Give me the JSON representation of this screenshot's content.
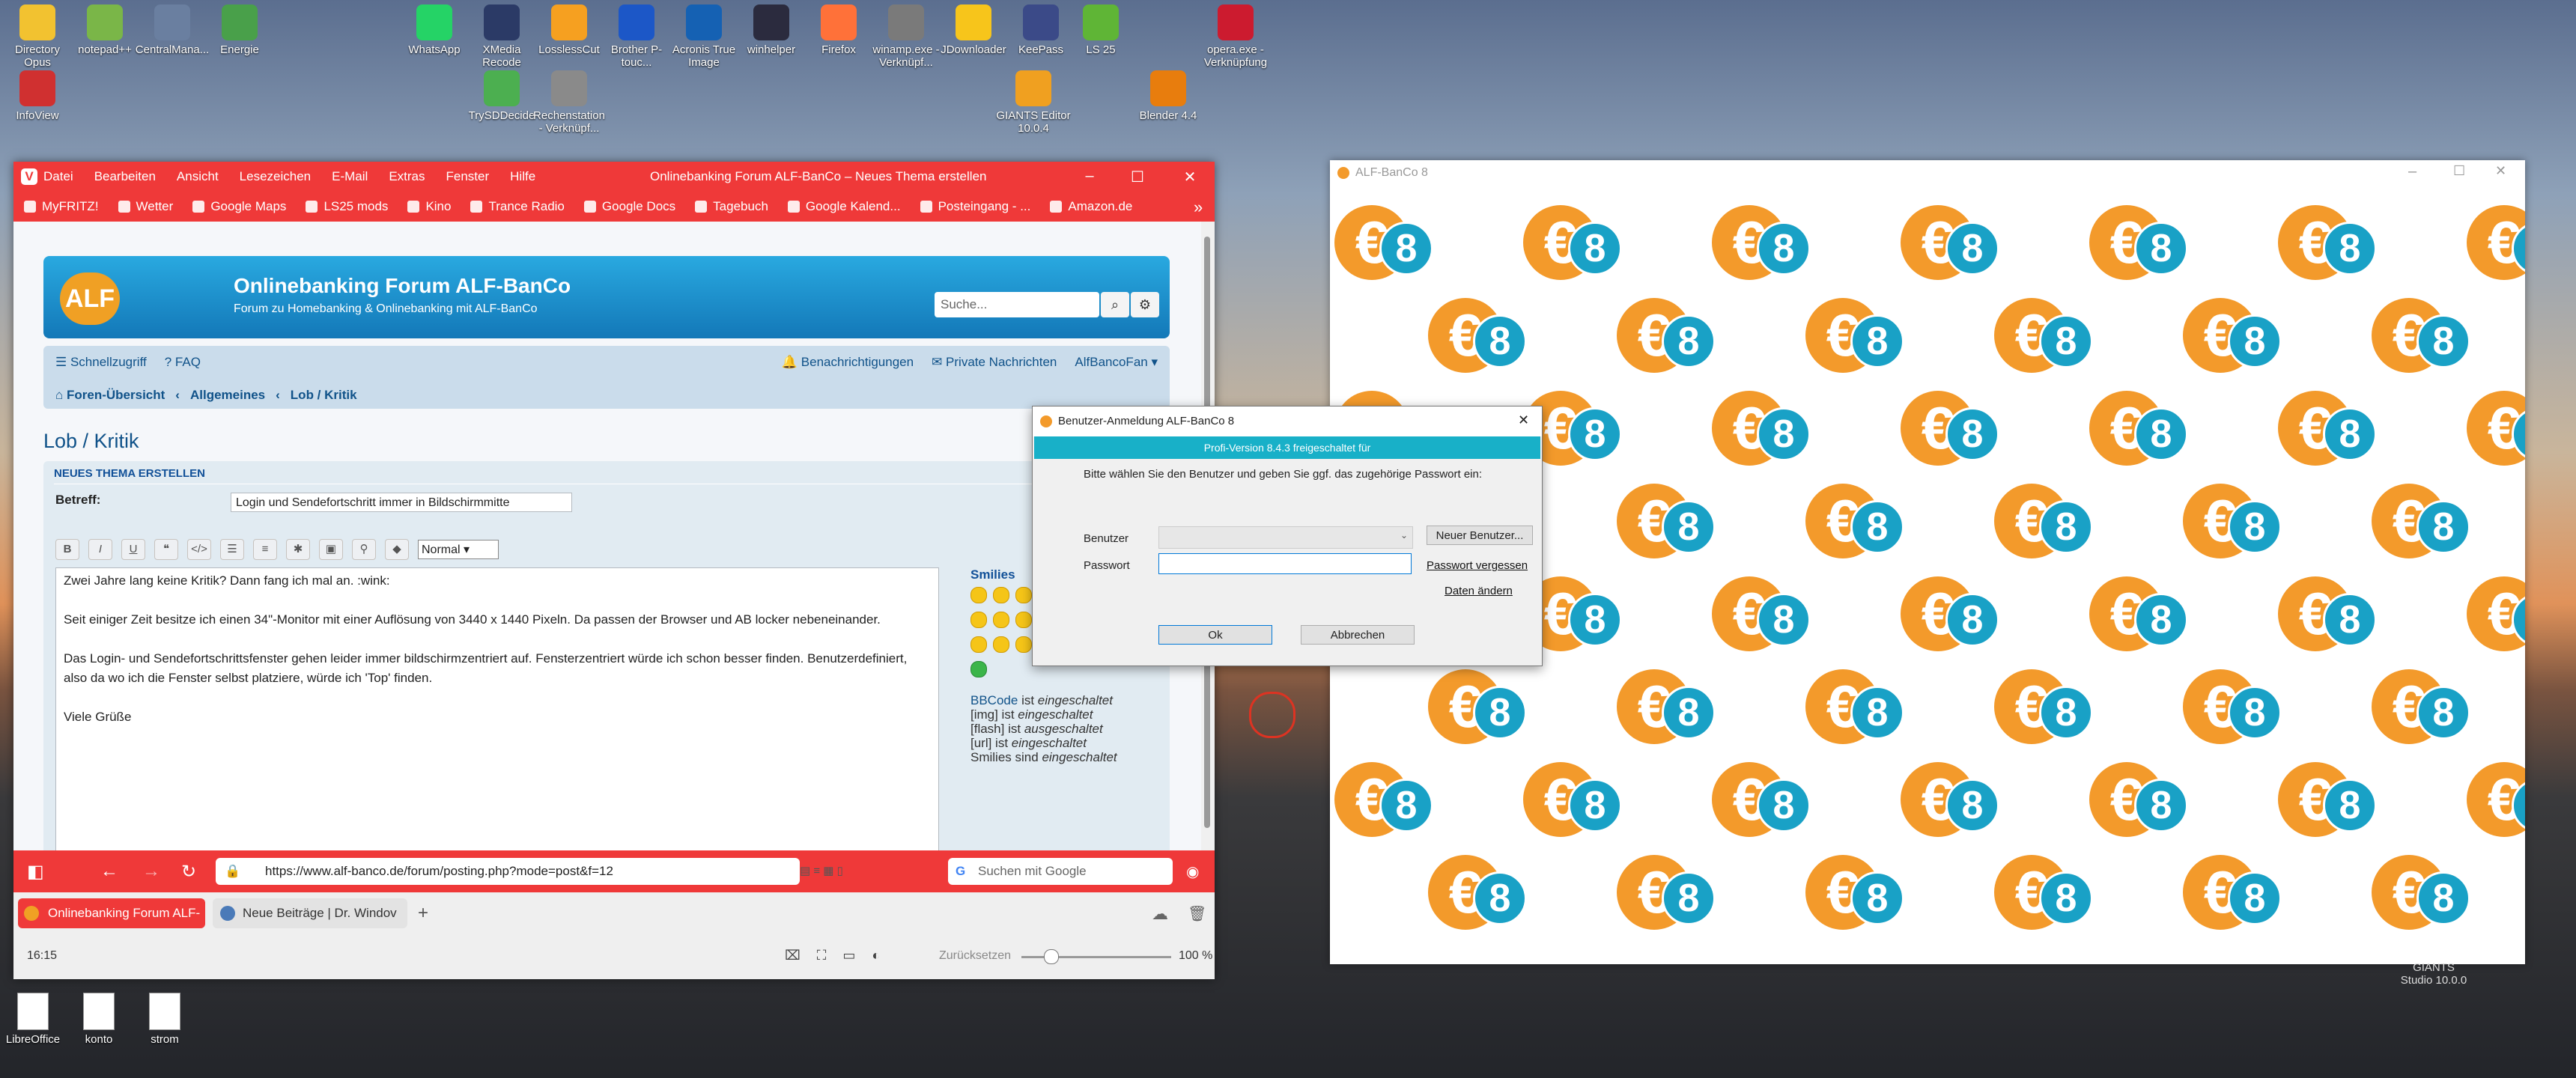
{
  "desktop": {
    "icons_top": [
      {
        "label": "Directory Opus",
        "color": "#f2c230"
      },
      {
        "label": "notepad++",
        "color": "#7ab648"
      },
      {
        "label": "CentralMana...",
        "color": "#6a7fa0"
      },
      {
        "label": "Energie",
        "color": "#49a04a"
      },
      {
        "label": "WhatsApp",
        "color": "#25d366"
      },
      {
        "label": "XMedia Recode",
        "color": "#2b3a66"
      },
      {
        "label": "LosslessCut",
        "color": "#f6a020"
      },
      {
        "label": "Brother P-touc...",
        "color": "#1c57c7"
      },
      {
        "label": "Acronis True Image",
        "color": "#1561b3"
      },
      {
        "label": "winhelper",
        "color": "#2b2b3e"
      },
      {
        "label": "Firefox",
        "color": "#ff7139"
      },
      {
        "label": "winamp.exe - Verknüpf...",
        "color": "#7a7a7a"
      },
      {
        "label": "JDownloader",
        "color": "#f7c51b"
      },
      {
        "label": "KeePass",
        "color": "#3b4a88"
      },
      {
        "label": "LS 25",
        "color": "#5fb536"
      },
      {
        "label": "opera.exe - Verknüpfung",
        "color": "#cc1b2f"
      }
    ],
    "icons_row2": [
      {
        "label": "InfoView",
        "color": "#d03030"
      },
      {
        "label": "TrySDDecide",
        "color": "#4caf50"
      },
      {
        "label": "Rechenstation - Verknüpf...",
        "color": "#8a8a8a"
      },
      {
        "label": "GIANTS Editor 10.0.4",
        "color": "#f0a020"
      },
      {
        "label": "Blender 4.4",
        "color": "#e87d0d"
      }
    ],
    "icons_bottom": [
      "LibreOffice",
      "konto",
      "strom"
    ],
    "giants_label": "GIANTS Studio 10.0.0"
  },
  "browser": {
    "menu": [
      "Datei",
      "Bearbeiten",
      "Ansicht",
      "Lesezeichen",
      "E-Mail",
      "Extras",
      "Fenster",
      "Hilfe"
    ],
    "title": "Onlinebanking Forum ALF-BanCo – Neues Thema erstellen",
    "bookmarks": [
      "MyFRITZ!",
      "Wetter",
      "Google Maps",
      "LS25 mods",
      "Kino",
      "Trance Radio",
      "Google Docs",
      "Tagebuch",
      "Google Kalend...",
      "Posteingang - ...",
      "Amazon.de"
    ],
    "url": "https://www.alf-banco.de/forum/posting.php?mode=post&f=12",
    "search_placeholder": "Suchen mit Google",
    "tabs": [
      "Onlinebanking Forum ALF-",
      "Neue Beiträge | Dr. Windov"
    ],
    "status": {
      "time": "16:15",
      "reset": "Zurücksetzen",
      "zoom": "100 %"
    }
  },
  "forum": {
    "logo": "ALF",
    "title": "Onlinebanking Forum ALF-BanCo",
    "subtitle": "Forum zu Homebanking & Onlinebanking mit ALF-BanCo",
    "search_placeholder": "Suche...",
    "nav_left": [
      "Schnellzugriff",
      "FAQ"
    ],
    "nav_right": [
      "Benachrichtigungen",
      "Private Nachrichten",
      "AlfBancoFan"
    ],
    "breadcrumb": [
      "Foren-Übersicht",
      "Allgemeines",
      "Lob / Kritik"
    ],
    "page_title": "Lob / Kritik",
    "section": "NEUES THEMA ERSTELLEN",
    "subject_label": "Betreff:",
    "subject_value": "Login und Sendefortschritt immer in Bildschirmmitte",
    "font_size_select": "Normal",
    "message_lines": [
      "Zwei Jahre lang keine Kritik? Dann fang ich mal an.  :wink:",
      "Seit einiger Zeit besitze ich einen 34\"-Monitor mit einer Auflösung von 3440 x 1440 Pixeln. Da passen der Browser und AB locker nebeneinander.",
      "Das Login- und Sendefortschrittsfenster gehen leider immer bildschirmzentriert auf. Fensterzentriert würde ich schon besser finden. Benutzerdefiniert, also da wo ich die Fenster selbst platziere, würde ich 'Top' finden.",
      "Viele Grüße"
    ],
    "smilies_title": "Smilies",
    "bbcode": {
      "bbcode_link": "BBCode",
      "bbcode_rest": "ist",
      "bbcode_state": "eingeschaltet",
      "img": "[img] ist",
      "img_state": "eingeschaltet",
      "flash": "[flash] ist",
      "flash_state": "ausgeschaltet",
      "url": "[url] ist",
      "url_state": "eingeschaltet",
      "smilies": "Smilies sind",
      "smilies_state": "eingeschaltet"
    }
  },
  "alf": {
    "title": "ALF-BanCo 8",
    "tile_euro": "€",
    "tile_num": "8"
  },
  "dialog": {
    "title": "Benutzer-Anmeldung ALF-BanCo 8",
    "band": "Profi-Version 8.4.3 freigeschaltet für",
    "instruction": "Bitte wählen Sie den Benutzer und geben Sie ggf. das zugehörige Passwort ein:",
    "user_label": "Benutzer",
    "password_label": "Passwort",
    "new_user": "Neuer Benutzer...",
    "forgot": "Passwort vergessen",
    "change": "Daten ändern",
    "ok": "Ok",
    "cancel": "Abbrechen"
  }
}
